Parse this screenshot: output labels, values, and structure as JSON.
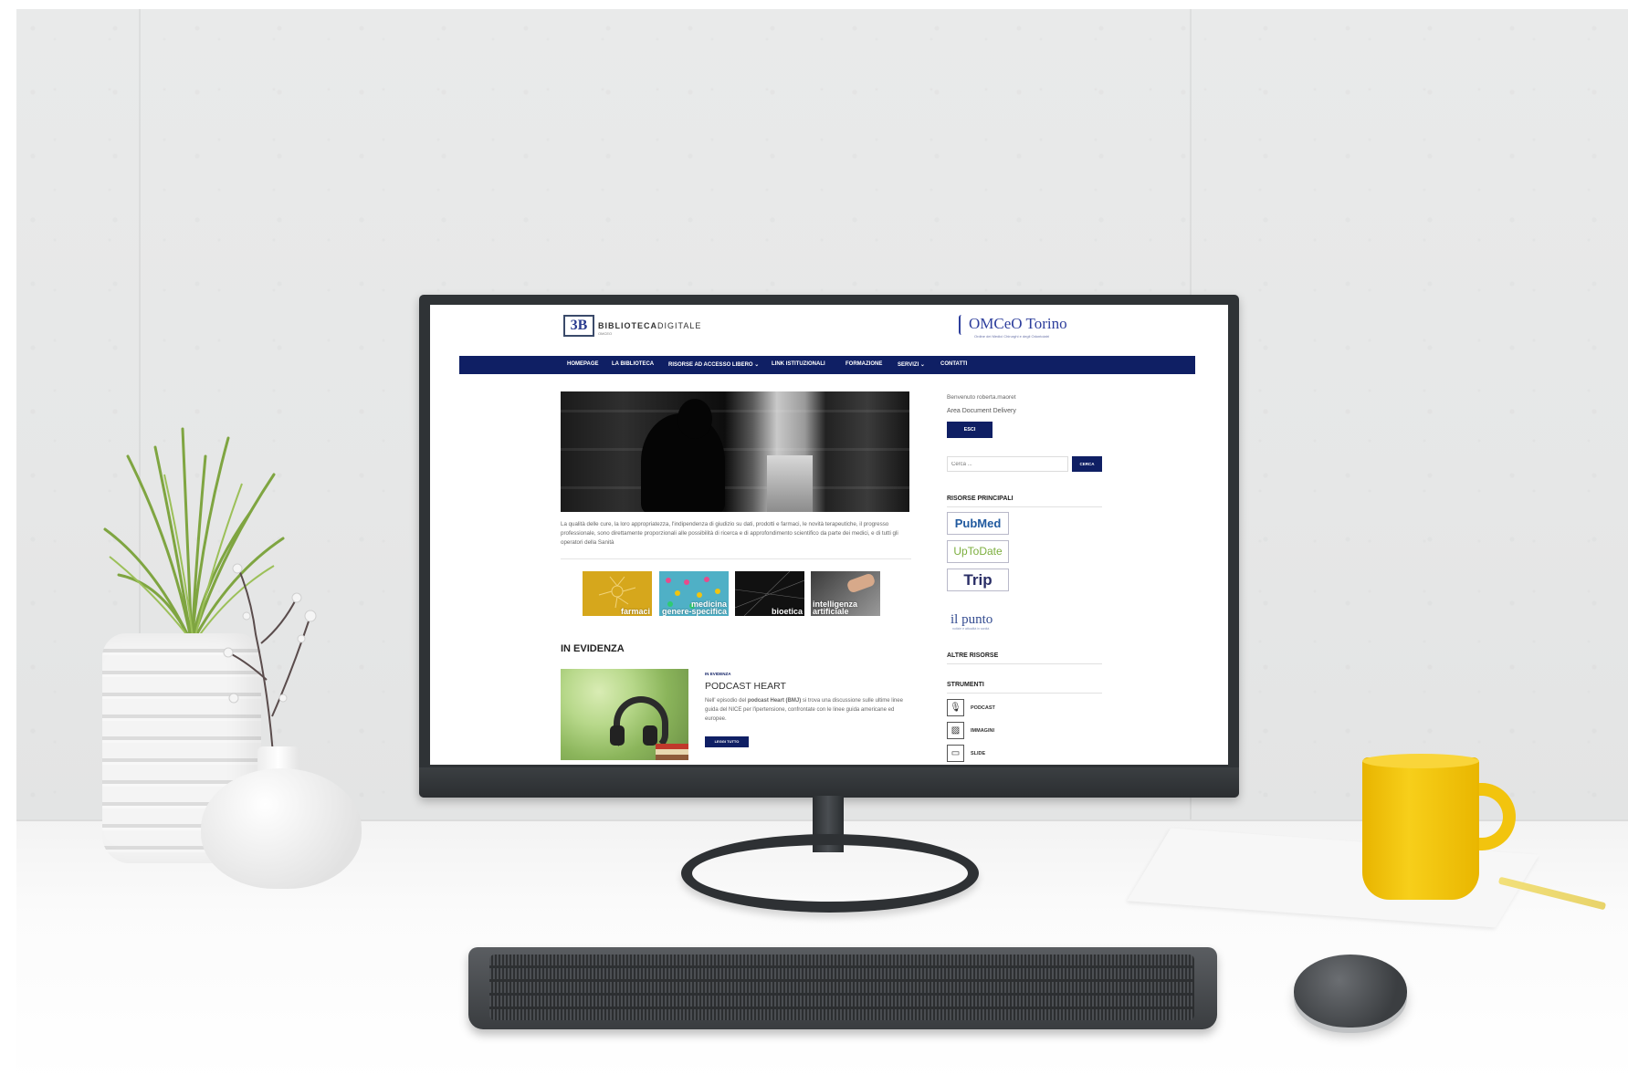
{
  "site": {
    "logo_mark": "3B",
    "logo_bold": "BIBLIOTECA",
    "logo_light": "DIGITALE",
    "logo_sub": "OMCEO",
    "partner_name": "OMCeO Torino",
    "partner_sub": "Ordine dei Medici Chirurghi e degli Odontoiatri"
  },
  "nav": {
    "items": [
      {
        "label": "HOMEPAGE"
      },
      {
        "label": "LA BIBLIOTECA"
      },
      {
        "label": "RISORSE AD ACCESSO LIBERO ⌄"
      },
      {
        "label": "LINK ISTITUZIONALI"
      },
      {
        "label": "FORMAZIONE"
      },
      {
        "label": "SERVIZI ⌄"
      },
      {
        "label": "CONTATTI"
      }
    ]
  },
  "intro_text": "La qualità delle cure, la loro appropriatezza, l'indipendenza di giudizio su dati, prodotti e farmaci, le novità terapeutiche, il progresso professionale, sono direttamente proporzionali alle possibilità di ricerca e di approfondimento scientifico da parte dei medici, e di tutti gli operatori della Sanità",
  "tiles": [
    {
      "label": "farmaci",
      "color": "#d6a71c"
    },
    {
      "label": "medicina\ngenere-specifica",
      "color": "#4fb0c6"
    },
    {
      "label": "bioetica",
      "color": "#111111"
    },
    {
      "label": "intelligenza\nartificiale",
      "color": "#6c6c6c"
    }
  ],
  "evidenza": {
    "section_title": "IN EVIDENZA",
    "category": "IN EVIDENZA",
    "title": "PODCAST HEART",
    "text_pre": "Nell' episodio del ",
    "text_bold": "podcast Heart (BMJ)",
    "text_post": " si trova una discussione sulle ultime linee guida del NICE per l'ipertensione, confrontate con le linee guida americane ed europee.",
    "button": "LEGGI TUTTO"
  },
  "sidebar": {
    "welcome": "Benvenuto roberta.maoret",
    "area": "Area Document Delivery",
    "logout": "ESCI",
    "search_placeholder": "Cerca ...",
    "search_button": "CERCA",
    "resources_title": "RISORSE PRINCIPALI",
    "resources": [
      "PubMed",
      "UpToDate",
      "Trip"
    ],
    "punto": "il punto",
    "punto_sub": "notizie e attualità in sanità",
    "other_title": "ALTRE RISORSE",
    "tools_title": "STRUMENTI",
    "tools": [
      {
        "label": "PODCAST",
        "icon": "microphone-icon"
      },
      {
        "label": "IMMAGINI",
        "icon": "image-icon"
      },
      {
        "label": "SLIDE",
        "icon": "slide-icon"
      }
    ]
  },
  "colors": {
    "navy": "#0f1f64",
    "mug": "#f2c40e"
  }
}
